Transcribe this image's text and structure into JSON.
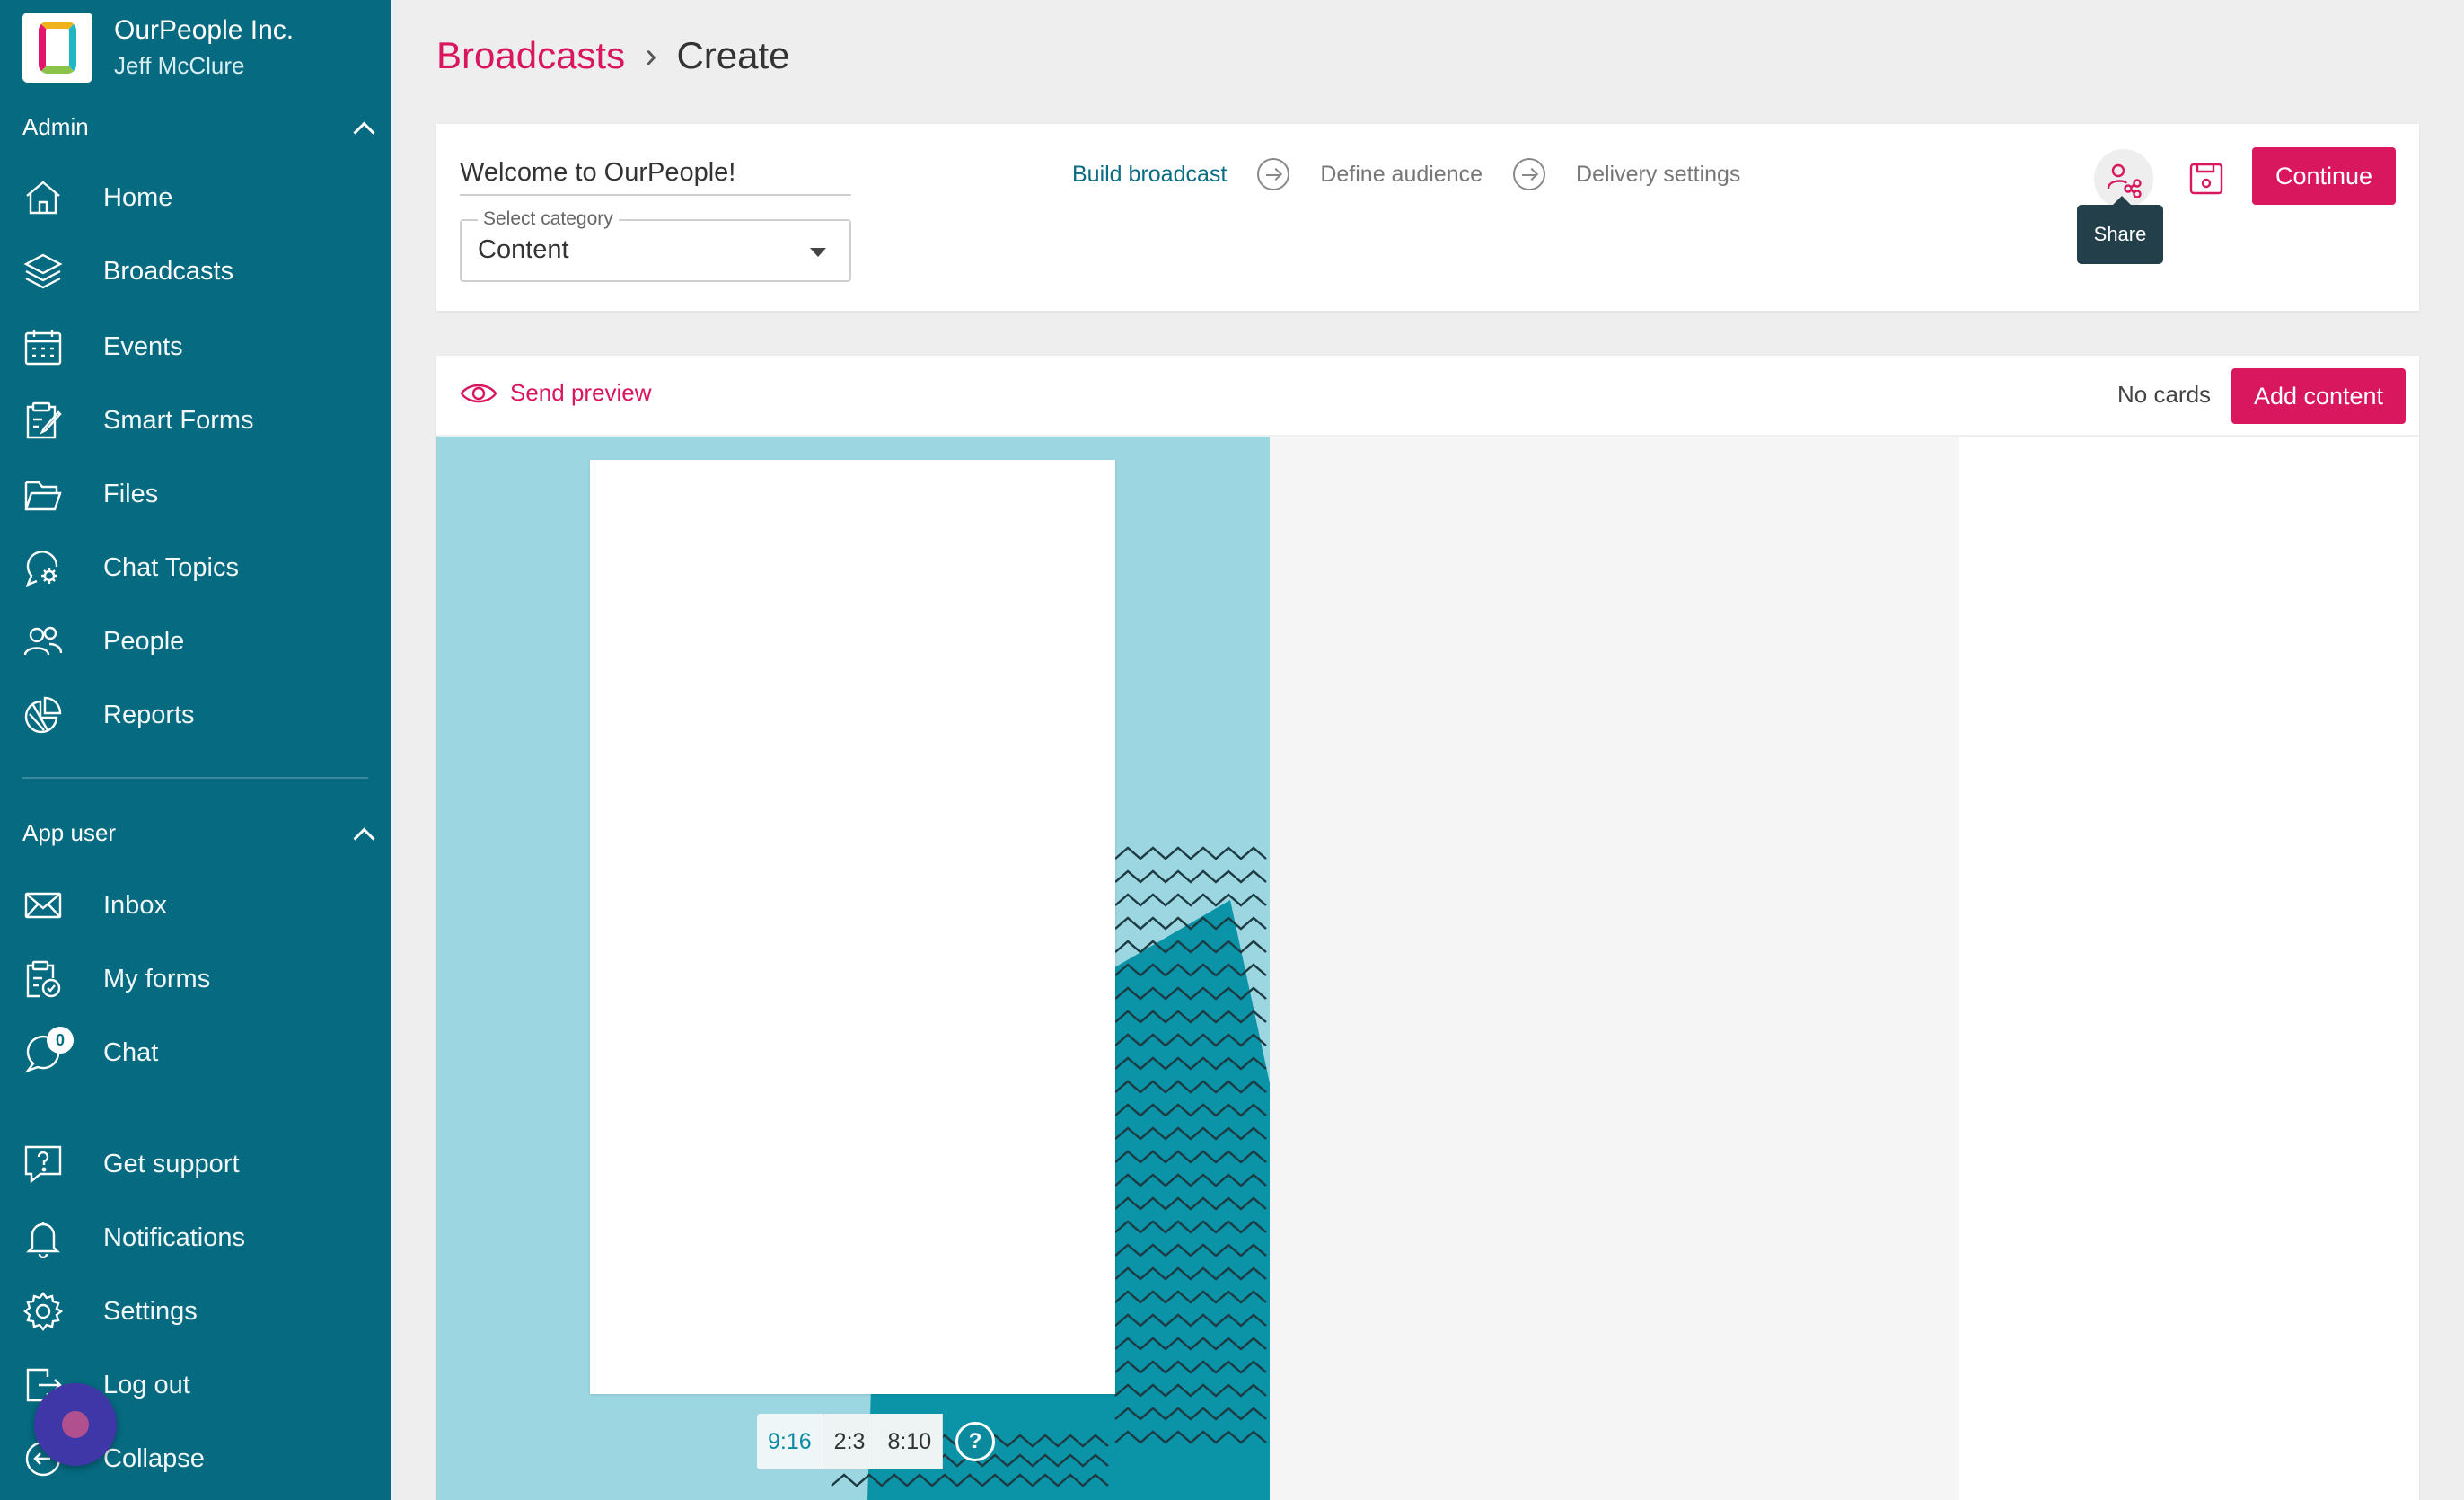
{
  "sidebar": {
    "org_name": "OurPeople Inc.",
    "user_name": "Jeff McClure",
    "admin_label": "Admin",
    "admin_items": [
      {
        "label": "Home",
        "icon": "home-icon"
      },
      {
        "label": "Broadcasts",
        "icon": "layers-icon"
      },
      {
        "label": "Events",
        "icon": "calendar-icon"
      },
      {
        "label": "Smart Forms",
        "icon": "form-edit-icon"
      },
      {
        "label": "Files",
        "icon": "folder-icon"
      },
      {
        "label": "Chat Topics",
        "icon": "chat-gear-icon"
      },
      {
        "label": "People",
        "icon": "people-icon"
      },
      {
        "label": "Reports",
        "icon": "pie-chart-icon"
      }
    ],
    "app_user_label": "App user",
    "app_items": [
      {
        "label": "Inbox",
        "icon": "envelope-icon"
      },
      {
        "label": "My forms",
        "icon": "clipboard-check-icon"
      },
      {
        "label": "Chat",
        "icon": "chat-bubble-icon",
        "badge": "0"
      }
    ],
    "bottom_items": [
      {
        "label": "Get support",
        "icon": "help-icon"
      },
      {
        "label": "Notifications",
        "icon": "bell-icon"
      },
      {
        "label": "Settings",
        "icon": "gear-icon"
      },
      {
        "label": "Log out",
        "icon": "logout-icon"
      },
      {
        "label": "Collapse",
        "icon": "collapse-icon"
      }
    ]
  },
  "breadcrumb": {
    "parent": "Broadcasts",
    "separator": "›",
    "current": "Create"
  },
  "header": {
    "title_value": "Welcome to OurPeople!",
    "category_label": "Select category",
    "category_value": "Content",
    "steps": [
      "Build broadcast",
      "Define audience",
      "Delivery settings"
    ],
    "share_tooltip": "Share",
    "continue_label": "Continue"
  },
  "editor": {
    "send_preview_label": "Send preview",
    "cards_status": "No cards",
    "add_content_label": "Add content",
    "ratios": [
      "9:16",
      "2:3",
      "8:10"
    ],
    "help_glyph": "?"
  },
  "colors": {
    "sidebar_bg": "#066a80",
    "accent": "#d9175f",
    "step_active": "#0b6c83",
    "canvas_bg": "#9cd6e0"
  }
}
